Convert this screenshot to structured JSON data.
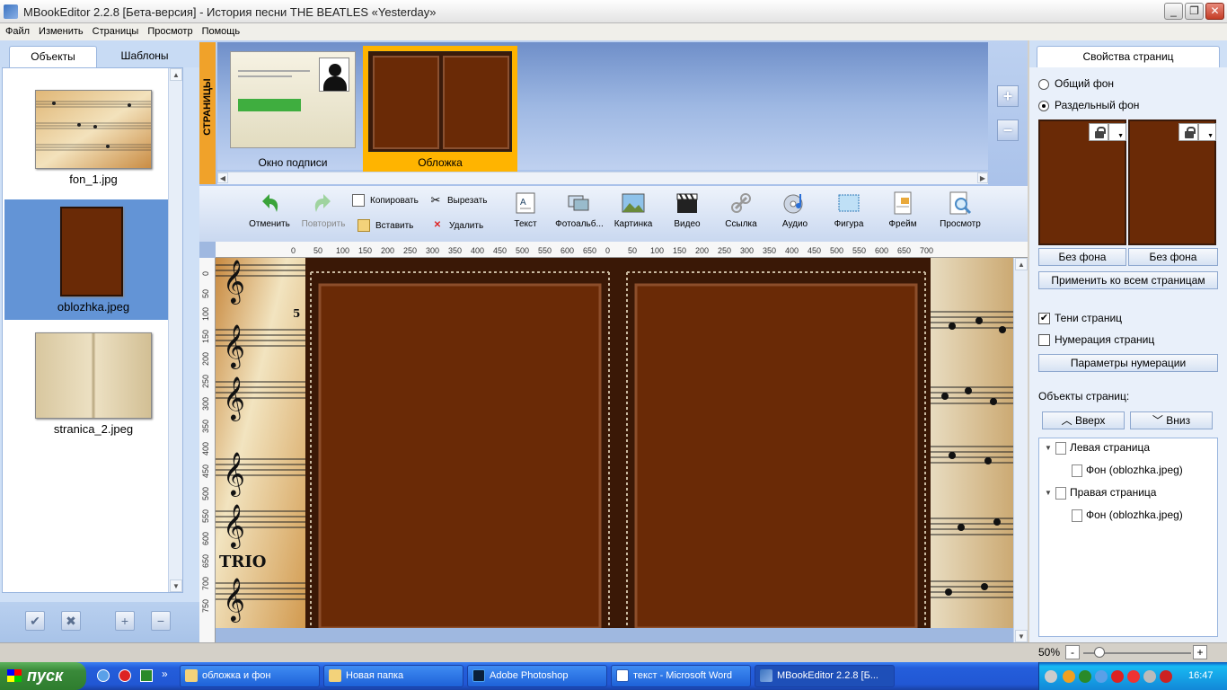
{
  "window": {
    "title": "MBookEditor 2.2.8 [Бета-версия] - История песни THE BEATLES «Yesterday»",
    "buttons": {
      "minimize": "_",
      "maximize": "❐",
      "close": "✕"
    }
  },
  "menu": [
    "Файл",
    "Изменить",
    "Страницы",
    "Просмотр",
    "Помощь"
  ],
  "left_panel": {
    "tabs": [
      "Объекты",
      "Шаблоны"
    ],
    "active_tab": "Объекты",
    "objects": [
      {
        "name": "fon_1.jpg",
        "selected": false
      },
      {
        "name": "oblozhka.jpeg",
        "selected": true
      },
      {
        "name": "stranica_2.jpeg",
        "selected": false
      }
    ],
    "buttons": [
      "✔",
      "✖",
      "+",
      "−"
    ]
  },
  "pages_bar": {
    "label": "СТРАНИЦЫ",
    "pages": [
      {
        "caption": "Окно подписи",
        "selected": false
      },
      {
        "caption": "Обложка",
        "selected": true
      }
    ],
    "plus": "+",
    "minus": "−"
  },
  "toolbar": {
    "undo": "Отменить",
    "redo": "Повторить",
    "copy": "Копировать",
    "paste": "Вставить",
    "cut": "Вырезать",
    "delete": "Удалить",
    "text": "Текст",
    "photo_album": "Фотоальб...",
    "picture": "Картинка",
    "video": "Видео",
    "link": "Ссылка",
    "audio": "Аудио",
    "shape": "Фигура",
    "frame": "Фрейм",
    "preview": "Просмотр"
  },
  "ruler": {
    "h_ticks_left": [
      "0",
      "50",
      "100",
      "150",
      "200",
      "250",
      "300",
      "350",
      "400",
      "450",
      "500",
      "550",
      "600",
      "650"
    ],
    "h_ticks_right": [
      "0",
      "50",
      "100",
      "150",
      "200",
      "250",
      "300",
      "350",
      "400",
      "450",
      "500",
      "550",
      "600",
      "650",
      "700"
    ],
    "v_ticks": [
      "0",
      "50",
      "100",
      "150",
      "200",
      "250",
      "300",
      "350",
      "400",
      "450",
      "500",
      "550",
      "600",
      "650",
      "700",
      "750"
    ]
  },
  "canvas": {
    "trio_text": "TRIO",
    "number_5": "5"
  },
  "right_panel": {
    "header": "Свойства страниц",
    "radio_common": "Общий фон",
    "radio_separate": "Раздельный фон",
    "separate_selected": true,
    "no_bg_left": "Без фона",
    "no_bg_right": "Без фона",
    "apply_all": "Применить ко всем страницам",
    "shadows_label": "Тени страниц",
    "shadows_checked": true,
    "numbering_label": "Нумерация страниц",
    "numbering_checked": false,
    "numbering_params": "Параметры нумерации",
    "objects_title": "Объекты страниц:",
    "up": "Вверх",
    "down": "Вниз",
    "tree": [
      {
        "label": "Левая страница",
        "child": "Фон (oblozhka.jpeg)"
      },
      {
        "label": "Правая страница",
        "child": "Фон (oblozhka.jpeg)"
      }
    ]
  },
  "status": {
    "zoom": "50%",
    "zoom_level": 0.1
  },
  "taskbar": {
    "start": "пуск",
    "tasks": [
      "облoжка и фон",
      "Новая папка",
      "Adobe Photoshop",
      "текст - Microsoft Word",
      "MBookEditor 2.2.8 [Б..."
    ],
    "clock": "16:47"
  },
  "colors": {
    "cover_brown": "#6a2a06",
    "selection_orange": "#ffb400",
    "selection_blue": "#6394d6",
    "pages_label": "#f0a22a"
  }
}
